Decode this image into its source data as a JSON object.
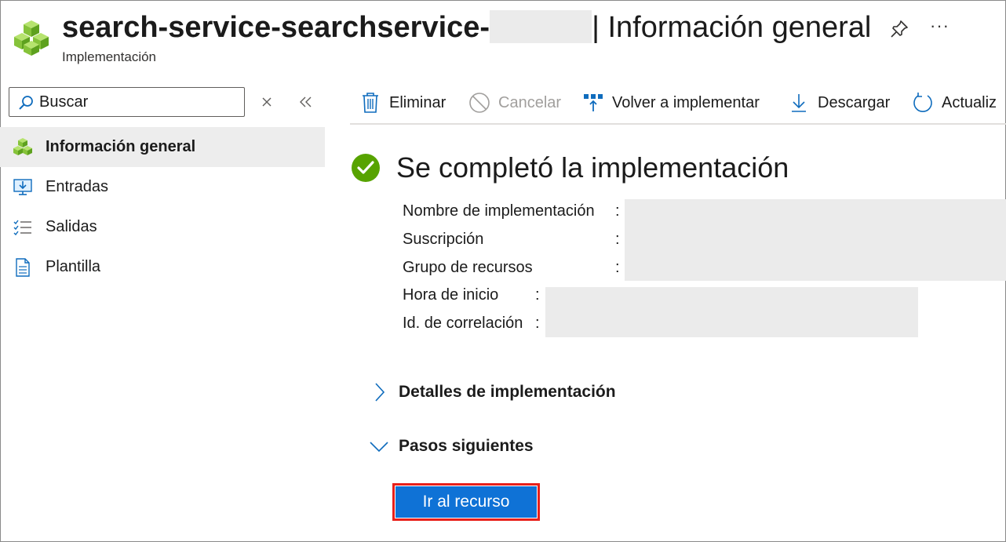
{
  "header": {
    "title_prefix": "search-service-searchservice-",
    "title_separator": "| Información general",
    "subtitle": "Implementación",
    "pin_icon": "pin-icon",
    "more_label": "···"
  },
  "sidebar": {
    "search": {
      "placeholder": "Buscar",
      "value": ""
    },
    "items": [
      {
        "label": "Información general",
        "icon": "overview-cubes-icon",
        "active": true
      },
      {
        "label": "Entradas",
        "icon": "inputs-icon",
        "active": false
      },
      {
        "label": "Salidas",
        "icon": "outputs-list-icon",
        "active": false
      },
      {
        "label": "Plantilla",
        "icon": "template-document-icon",
        "active": false
      }
    ]
  },
  "toolbar": {
    "delete_label": "Eliminar",
    "cancel_label": "Cancelar",
    "redeploy_label": "Volver a implementar",
    "download_label": "Descargar",
    "refresh_label": "Actualiz"
  },
  "main": {
    "status_heading": "Se completó la implementación",
    "fields": [
      {
        "label": "Nombre de implementación"
      },
      {
        "label": "Suscripción"
      },
      {
        "label": "Grupo de recursos"
      },
      {
        "label": "Hora de inicio"
      },
      {
        "label": "Id. de correlación"
      }
    ],
    "colon": ":",
    "sections": {
      "details": "Detalles de implementación",
      "next_steps": "Pasos siguientes"
    },
    "go_to_resource": "Ir al recurso"
  },
  "colors": {
    "accent": "#0f72d6",
    "success": "#57a300",
    "highlight_border": "#e8201a",
    "active_bg": "#ededed"
  }
}
